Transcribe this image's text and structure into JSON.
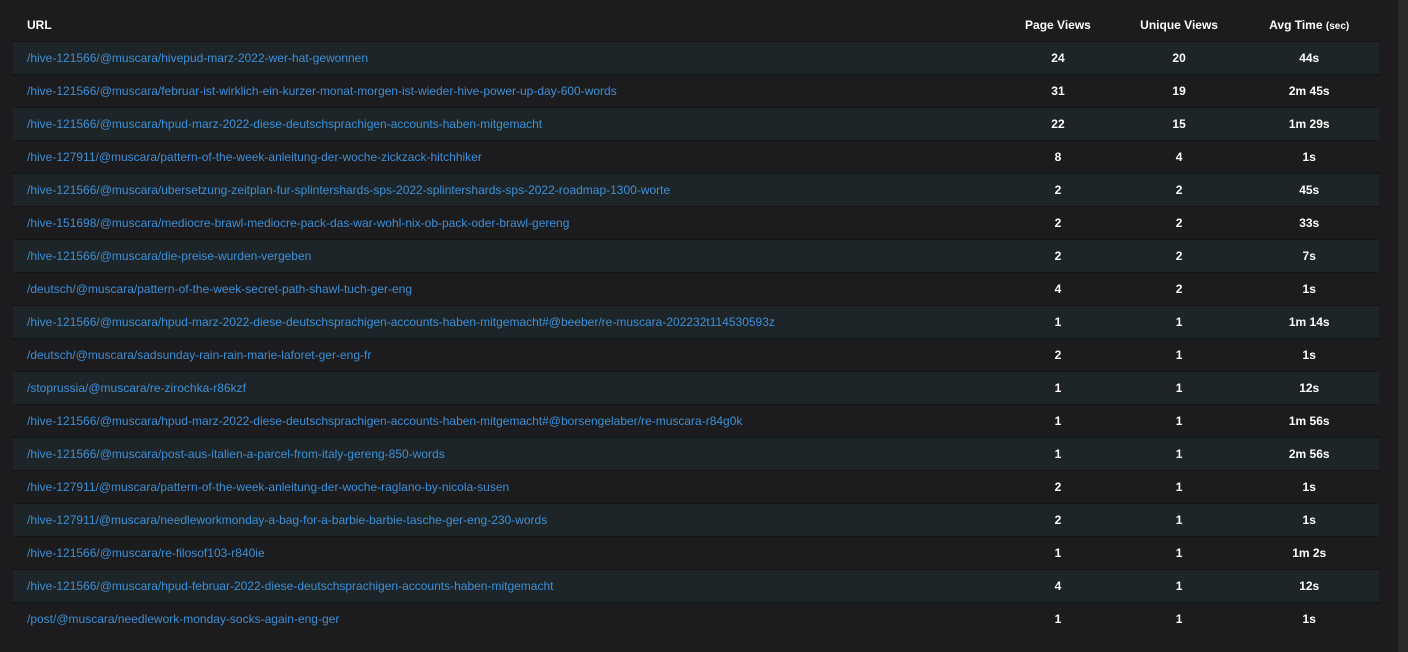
{
  "table": {
    "headers": {
      "url": "URL",
      "page_views": "Page Views",
      "unique_views": "Unique Views",
      "avg_time": "Avg Time",
      "avg_time_unit": "(sec)"
    },
    "rows": [
      {
        "url": "/hive-121566/@muscara/hivepud-marz-2022-wer-hat-gewonnen",
        "page_views": "24",
        "unique_views": "20",
        "avg_time": "44s"
      },
      {
        "url": "/hive-121566/@muscara/februar-ist-wirklich-ein-kurzer-monat-morgen-ist-wieder-hive-power-up-day-600-words",
        "page_views": "31",
        "unique_views": "19",
        "avg_time": "2m 45s"
      },
      {
        "url": "/hive-121566/@muscara/hpud-marz-2022-diese-deutschsprachigen-accounts-haben-mitgemacht",
        "page_views": "22",
        "unique_views": "15",
        "avg_time": "1m 29s"
      },
      {
        "url": "/hive-127911/@muscara/pattern-of-the-week-anleitung-der-woche-zickzack-hitchhiker",
        "page_views": "8",
        "unique_views": "4",
        "avg_time": "1s"
      },
      {
        "url": "/hive-121566/@muscara/ubersetzung-zeitplan-fur-splintershards-sps-2022-splintershards-sps-2022-roadmap-1300-worte",
        "page_views": "2",
        "unique_views": "2",
        "avg_time": "45s"
      },
      {
        "url": "/hive-151698/@muscara/mediocre-brawl-mediocre-pack-das-war-wohl-nix-ob-pack-oder-brawl-gereng",
        "page_views": "2",
        "unique_views": "2",
        "avg_time": "33s"
      },
      {
        "url": "/hive-121566/@muscara/die-preise-wurden-vergeben",
        "page_views": "2",
        "unique_views": "2",
        "avg_time": "7s"
      },
      {
        "url": "/deutsch/@muscara/pattern-of-the-week-secret-path-shawl-tuch-ger-eng",
        "page_views": "4",
        "unique_views": "2",
        "avg_time": "1s"
      },
      {
        "url": "/hive-121566/@muscara/hpud-marz-2022-diese-deutschsprachigen-accounts-haben-mitgemacht#@beeber/re-muscara-202232t114530593z",
        "page_views": "1",
        "unique_views": "1",
        "avg_time": "1m 14s"
      },
      {
        "url": "/deutsch/@muscara/sadsunday-rain-rain-marie-laforet-ger-eng-fr",
        "page_views": "2",
        "unique_views": "1",
        "avg_time": "1s"
      },
      {
        "url": "/stoprussia/@muscara/re-zirochka-r86kzf",
        "page_views": "1",
        "unique_views": "1",
        "avg_time": "12s"
      },
      {
        "url": "/hive-121566/@muscara/hpud-marz-2022-diese-deutschsprachigen-accounts-haben-mitgemacht#@borsengelaber/re-muscara-r84g0k",
        "page_views": "1",
        "unique_views": "1",
        "avg_time": "1m 56s"
      },
      {
        "url": "/hive-121566/@muscara/post-aus-italien-a-parcel-from-italy-gereng-850-words",
        "page_views": "1",
        "unique_views": "1",
        "avg_time": "2m 56s"
      },
      {
        "url": "/hive-127911/@muscara/pattern-of-the-week-anleitung-der-woche-raglano-by-nicola-susen",
        "page_views": "2",
        "unique_views": "1",
        "avg_time": "1s"
      },
      {
        "url": "/hive-127911/@muscara/needleworkmonday-a-bag-for-a-barbie-barbie-tasche-ger-eng-230-words",
        "page_views": "2",
        "unique_views": "1",
        "avg_time": "1s"
      },
      {
        "url": "/hive-121566/@muscara/re-filosof103-r840ie",
        "page_views": "1",
        "unique_views": "1",
        "avg_time": "1m 2s"
      },
      {
        "url": "/hive-121566/@muscara/hpud-februar-2022-diese-deutschsprachigen-accounts-haben-mitgemacht",
        "page_views": "4",
        "unique_views": "1",
        "avg_time": "12s"
      },
      {
        "url": "/post/@muscara/needlework-monday-socks-again-eng-ger",
        "page_views": "1",
        "unique_views": "1",
        "avg_time": "1s"
      }
    ]
  },
  "colors": {
    "background": "#1c1c1e",
    "row_alt": "#1e2528",
    "link": "#3d8fd6",
    "text": "#ffffff"
  }
}
